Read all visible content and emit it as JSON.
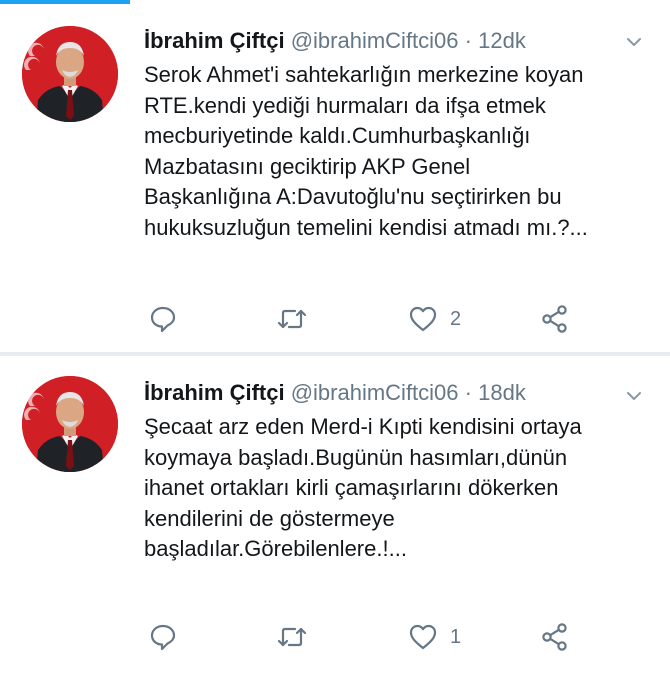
{
  "tweets": [
    {
      "author": {
        "name": "İbrahim Çiftçi",
        "handle": "@ibrahimCiftci06"
      },
      "separator": "·",
      "time": "12dk",
      "lines": [
        "Serok Ahmet'i sahtekarlığın merkezine koyan",
        "RTE.kendi yediği hurmaları da ifşa etmek",
        "mecburiyetinde kaldı.Cumhurbaşkanlığı",
        "Mazbatasını geciktirip AKP Genel",
        "Başkanlığına A:Davutoğlu'nu seçtirirken bu",
        "hukuksuzluğun temelini kendisi atmadı mı.?..."
      ],
      "actions": {
        "reply_icon": "reply-icon",
        "retweet_icon": "retweet-icon",
        "like_icon": "heart-icon",
        "like_count": "2",
        "share_icon": "share-icon"
      }
    },
    {
      "author": {
        "name": "İbrahim Çiftçi",
        "handle": "@ibrahimCiftci06"
      },
      "separator": "·",
      "time": "18dk",
      "lines": [
        "Şecaat arz eden Merd-i Kıpti kendisini ortaya",
        "koymaya başladı.Bugünün hasımları,dünün",
        "ihanet ortakları kirli çamaşırlarını dökerken",
        "kendilerini de göstermeye",
        "başladılar.Görebilenlere.!..."
      ],
      "actions": {
        "reply_icon": "reply-icon",
        "retweet_icon": "retweet-icon",
        "like_icon": "heart-icon",
        "like_count": "1",
        "share_icon": "share-icon"
      }
    }
  ],
  "colors": {
    "accent": "#1da1f2",
    "text": "#14171a",
    "muted": "#657786",
    "divider": "#e6ecf0",
    "avatar_bg": "#d11f26"
  }
}
